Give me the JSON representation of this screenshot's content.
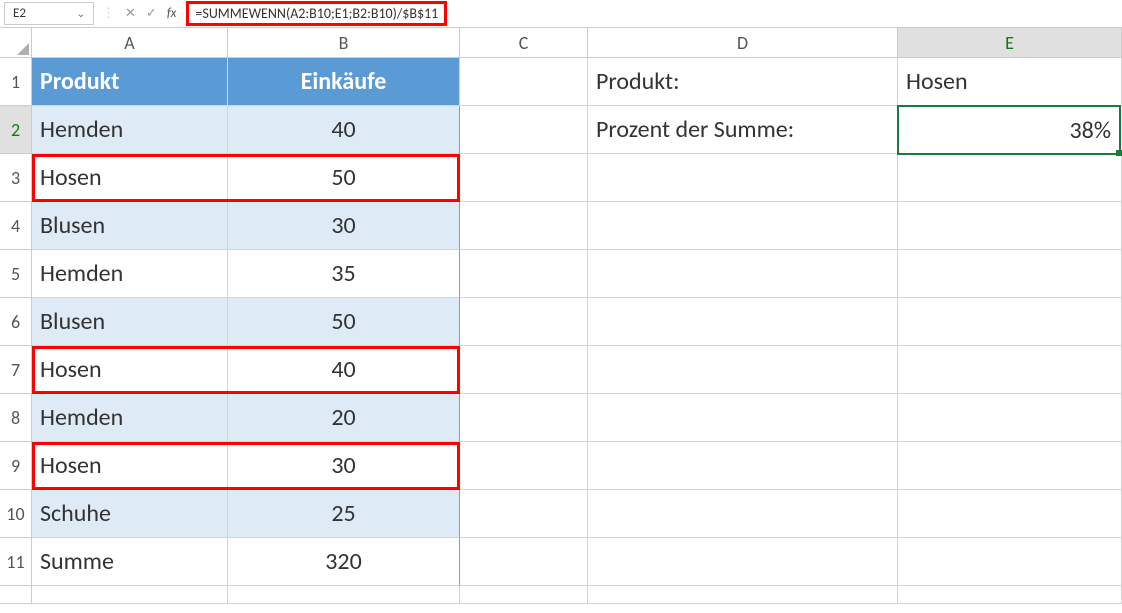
{
  "nameBox": "E2",
  "formula": "=SUMMEWENN(A2:B10;E1;B2:B10)/$B$11",
  "fxLabel": "fx",
  "columns": [
    "A",
    "B",
    "C",
    "D",
    "E"
  ],
  "headerRow": {
    "A": "Produkt",
    "B": "Einkäufe"
  },
  "dataRows": [
    {
      "n": 1,
      "A": "Produkt",
      "B": "Einkäufe",
      "D": "Produkt:",
      "E": "Hosen",
      "header": true
    },
    {
      "n": 2,
      "A": "Hemden",
      "B": "40",
      "D": "Prozent der Summe:",
      "E": "38%",
      "shaded": true,
      "selected": true
    },
    {
      "n": 3,
      "A": "Hosen",
      "B": "50",
      "highlight": true
    },
    {
      "n": 4,
      "A": "Blusen",
      "B": "30",
      "shaded": true
    },
    {
      "n": 5,
      "A": "Hemden",
      "B": "35"
    },
    {
      "n": 6,
      "A": "Blusen",
      "B": "50",
      "shaded": true
    },
    {
      "n": 7,
      "A": "Hosen",
      "B": "40",
      "highlight": true
    },
    {
      "n": 8,
      "A": "Hemden",
      "B": "20",
      "shaded": true
    },
    {
      "n": 9,
      "A": "Hosen",
      "B": "30",
      "highlight": true
    },
    {
      "n": 10,
      "A": "Schuhe",
      "B": "25",
      "shaded": true
    },
    {
      "n": 11,
      "A": "Summe",
      "B": "320"
    }
  ],
  "icons": {
    "cancel": "✕",
    "confirm": "✓",
    "chevron": "⌄",
    "divider": "⋮"
  }
}
